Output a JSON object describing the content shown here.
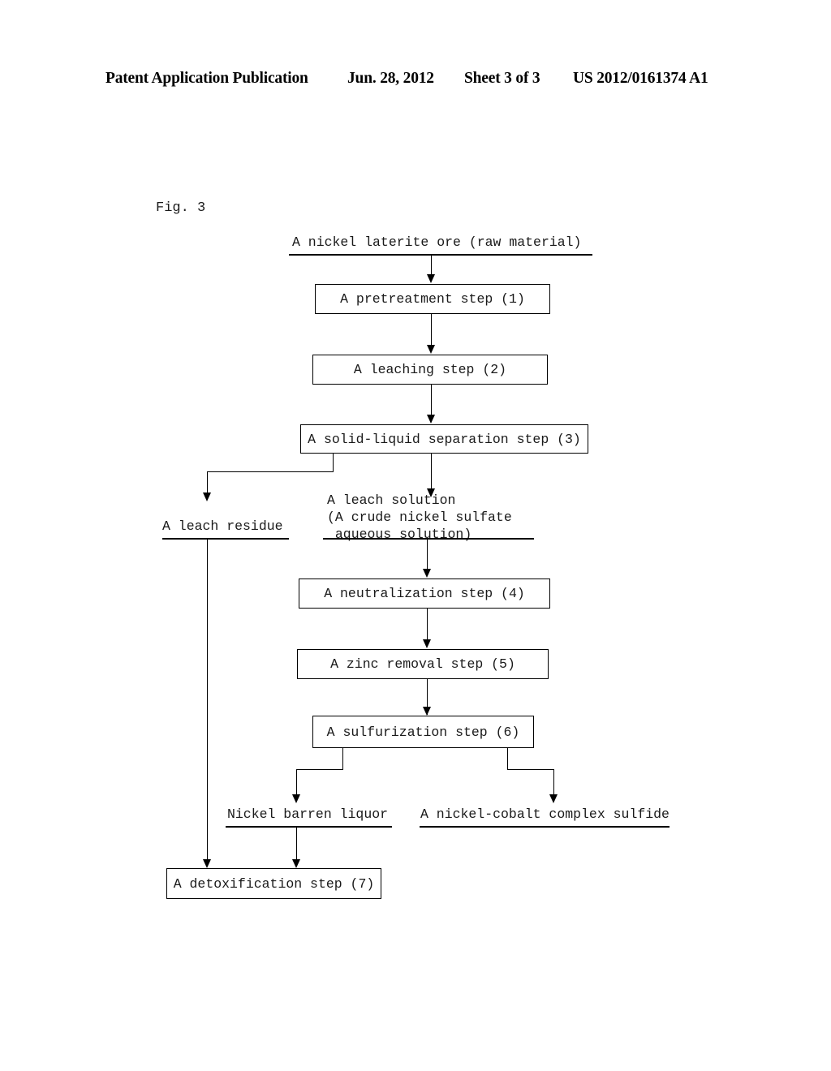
{
  "header": {
    "publication": "Patent Application Publication",
    "date": "Jun. 28, 2012",
    "sheet": "Sheet 3 of 3",
    "number": "US 2012/0161374 A1"
  },
  "figure": {
    "label": "Fig. 3"
  },
  "flowchart": {
    "type": "process-flow-diagram",
    "inputs": [
      {
        "id": "raw-material",
        "text": "A nickel laterite ore (raw material)"
      }
    ],
    "steps": [
      {
        "id": "step-1",
        "text": "A pretreatment step (1)"
      },
      {
        "id": "step-2",
        "text": "A leaching step (2)"
      },
      {
        "id": "step-3",
        "text": "A solid-liquid separation step (3)"
      },
      {
        "id": "step-4",
        "text": "A neutralization step (4)"
      },
      {
        "id": "step-5",
        "text": "A zinc removal step (5)"
      },
      {
        "id": "step-6",
        "text": "A sulfurization step (6)"
      },
      {
        "id": "step-7",
        "text": "A detoxification step (7)"
      }
    ],
    "streams": [
      {
        "id": "leach-residue",
        "text": "A leach residue"
      },
      {
        "id": "leach-solution",
        "line1": "A leach solution",
        "line2": "(A crude nickel sulfate",
        "line3": " aqueous solution)"
      },
      {
        "id": "nickel-barren-liquor",
        "text": "Nickel barren liquor"
      },
      {
        "id": "nickel-cobalt-sulfide",
        "text": "A nickel-cobalt complex sulfide"
      }
    ],
    "colors": {
      "line": "#000000",
      "text": "#1a1a1a",
      "background": "#ffffff"
    }
  }
}
